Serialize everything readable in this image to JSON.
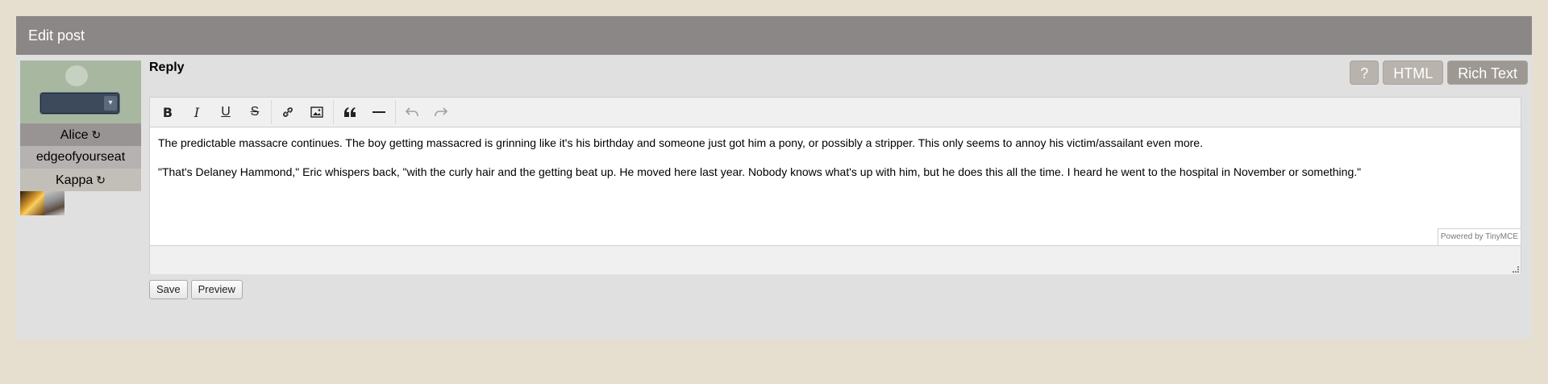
{
  "panel": {
    "title": "Edit post"
  },
  "user": {
    "character_select_value": "",
    "names": [
      {
        "label": "Alice",
        "refresh": true
      },
      {
        "label": "edgeofyourseat",
        "refresh": false
      },
      {
        "label": "Kappa",
        "refresh": true
      }
    ]
  },
  "reply": {
    "title": "Reply",
    "modes": {
      "help": "?",
      "html": "HTML",
      "rich": "Rich Text"
    }
  },
  "editor": {
    "paragraphs": [
      "The predictable massacre continues. The boy getting massacred is grinning like it's his birthday and someone just got him a pony, or possibly a stripper. This only seems to annoy his victim/assailant even more.",
      "\"That's Delaney Hammond,\" Eric whispers back, \"with the curly hair and the getting beat up. He moved here last year. Nobody knows what's up with him, but he does this all the time. I heard he went to the hospital in November or something.\""
    ],
    "powered_by": "Powered by TinyMCE"
  },
  "actions": {
    "save": "Save",
    "preview": "Preview"
  },
  "colors": {
    "header": "#8b8787",
    "panel": "#e0e0e0",
    "page": "#e6dfd0"
  }
}
